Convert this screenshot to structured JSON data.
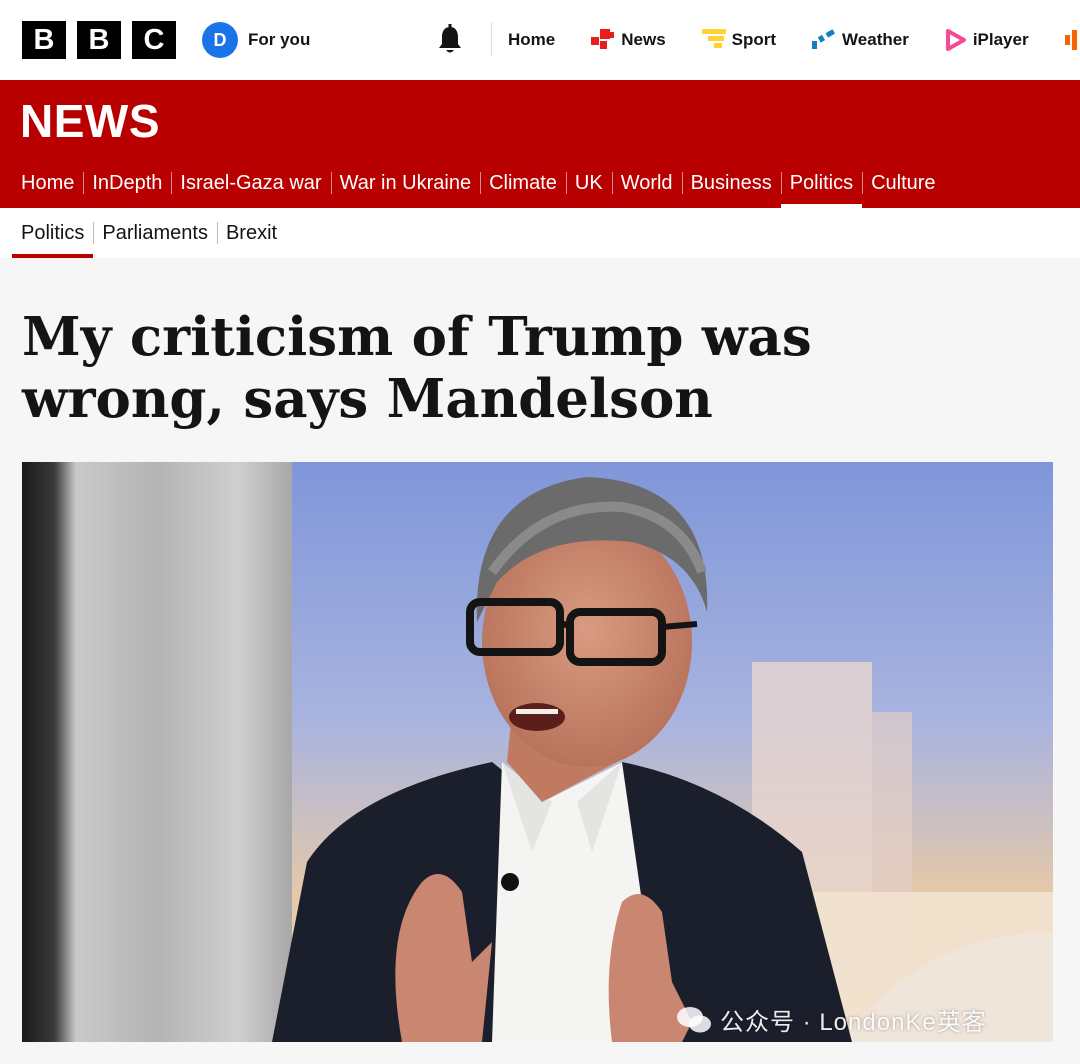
{
  "brand": {
    "logo_letters": [
      "B",
      "B",
      "C"
    ]
  },
  "account": {
    "initial": "D",
    "label": "For you"
  },
  "top_nav": [
    {
      "label": "Home",
      "icon": "none"
    },
    {
      "label": "News",
      "icon": "news-blocks-icon",
      "color": "#e81e1e"
    },
    {
      "label": "Sport",
      "icon": "sport-bars-icon",
      "color": "#ffd230"
    },
    {
      "label": "Weather",
      "icon": "weather-icon",
      "color": "#1380c3"
    },
    {
      "label": "iPlayer",
      "icon": "iplayer-play-icon",
      "color": "#f54996"
    },
    {
      "label": "",
      "icon": "sounds-icon",
      "color": "#fa6400"
    }
  ],
  "news_banner": {
    "title": "NEWS",
    "color": "#b80000"
  },
  "section_nav": [
    {
      "label": "Home",
      "active": false
    },
    {
      "label": "InDepth",
      "active": false
    },
    {
      "label": "Israel-Gaza war",
      "active": false
    },
    {
      "label": "War in Ukraine",
      "active": false
    },
    {
      "label": "Climate",
      "active": false
    },
    {
      "label": "UK",
      "active": false
    },
    {
      "label": "World",
      "active": false
    },
    {
      "label": "Business",
      "active": false
    },
    {
      "label": "Politics",
      "active": true
    },
    {
      "label": "Culture",
      "active": false
    }
  ],
  "sub_nav": [
    {
      "label": "Politics",
      "active": true
    },
    {
      "label": "Parliaments",
      "active": false
    },
    {
      "label": "Brexit",
      "active": false
    }
  ],
  "article": {
    "headline": "My criticism of Trump was wrong, says Mandelson"
  },
  "watermark": {
    "text": "公众号 · LondonKe英客"
  }
}
